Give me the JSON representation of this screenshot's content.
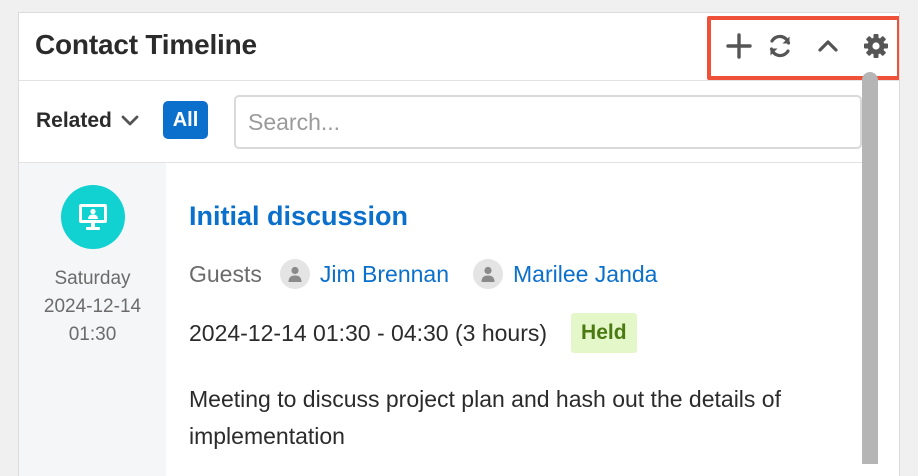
{
  "header": {
    "title": "Contact Timeline",
    "actions": [
      {
        "name": "add",
        "icon": "plus-icon"
      },
      {
        "name": "refresh",
        "icon": "refresh-icon"
      },
      {
        "name": "collapse",
        "icon": "chevron-up-icon"
      },
      {
        "name": "settings",
        "icon": "gear-icon"
      }
    ],
    "highlight_color": "#ef5138"
  },
  "toolbar": {
    "related_label": "Related",
    "filter_label": "All",
    "search_placeholder": "Search..."
  },
  "timeline": [
    {
      "type_icon": "meeting-icon",
      "day": "Saturday",
      "date": "2024-12-14",
      "time": "01:30",
      "subject": "Initial discussion",
      "guests_label": "Guests",
      "guests": [
        "Jim Brennan",
        "Marilee Janda"
      ],
      "time_range": "2024-12-14 01:30 - 04:30 (3 hours)",
      "status": "Held",
      "description": "Meeting to discuss project plan and hash out the details of implementation"
    }
  ],
  "colors": {
    "accent": "#0b6fcc",
    "meeting_badge": "#12d1d1",
    "status_bg": "#e4f7c9",
    "status_text": "#4c7a12"
  }
}
